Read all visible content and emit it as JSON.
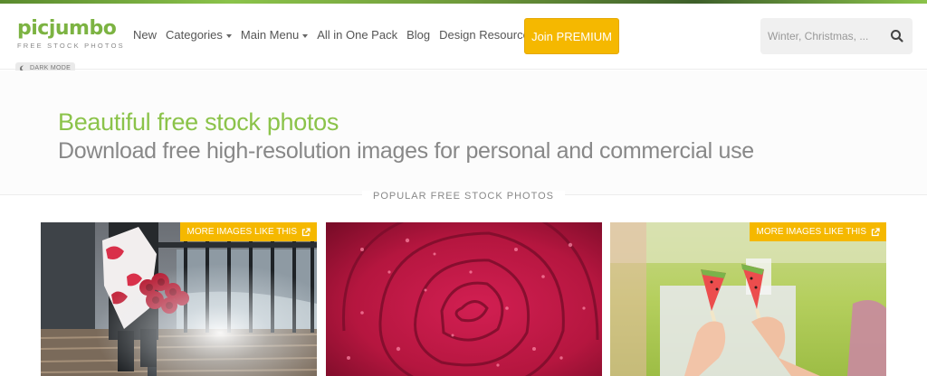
{
  "logo": {
    "name": "picjumbo",
    "tagline": "FREE STOCK PHOTOS"
  },
  "nav": {
    "items": [
      {
        "label": "New"
      },
      {
        "label": "Categories"
      },
      {
        "label": "Main Menu"
      },
      {
        "label": "All in One Pack"
      },
      {
        "label": "Blog"
      },
      {
        "label": "Design Resources"
      }
    ],
    "premium_label": "Join PREMIUM"
  },
  "search": {
    "placeholder": "Winter, Christmas, ...",
    "icon": "search-icon"
  },
  "dark_mode": {
    "label": "DARK MODE",
    "icon": "moon-icon"
  },
  "hero": {
    "title": "Beautiful free stock photos",
    "subtitle": "Download free high-resolution images for personal and commercial use"
  },
  "section": {
    "label": "POPULAR FREE STOCK PHOTOS"
  },
  "cards": [
    {
      "badge": "MORE IMAGES LIKE THIS",
      "badge_icon": "external-link-icon"
    },
    {
      "badge": ""
    },
    {
      "badge": "MORE IMAGES LIKE THIS",
      "badge_icon": "external-link-icon"
    }
  ],
  "colors": {
    "brand": "#8bc34a",
    "accent": "#f5b800"
  }
}
